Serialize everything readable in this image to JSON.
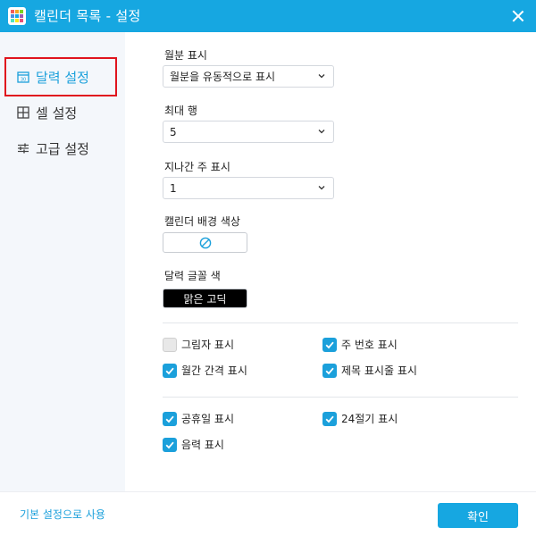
{
  "window": {
    "title": "캘린더 목록 - 설정",
    "accent_color": "#16a7e1"
  },
  "sidebar": {
    "items": [
      {
        "label": "달력 설정",
        "icon": "calendar-icon",
        "active": true
      },
      {
        "label": "셀 설정",
        "icon": "grid-icon",
        "active": false
      },
      {
        "label": "고급 설정",
        "icon": "sliders-icon",
        "active": false
      }
    ]
  },
  "main": {
    "monthly_display": {
      "label": "월분 표시",
      "value": "월분을 유동적으로 표시"
    },
    "max_rows": {
      "label": "최대 행",
      "value": "5"
    },
    "past_weeks": {
      "label": "지나간 주 표시",
      "value": "1"
    },
    "bg_color": {
      "label": "캘린더 배경 색상",
      "icon": "no-color-icon"
    },
    "font_color": {
      "label": "달력 글꼴 색",
      "value": "맑은 고딕"
    },
    "checkboxes_group1": [
      {
        "label": "그림자 표시",
        "checked": false
      },
      {
        "label": "주 번호 표시",
        "checked": true
      },
      {
        "label": "월간 간격 표시",
        "checked": true
      },
      {
        "label": "제목 표시줄 표시",
        "checked": true
      }
    ],
    "checkboxes_group2": [
      {
        "label": "공휴일 표시",
        "checked": true
      },
      {
        "label": "24절기 표시",
        "checked": true
      },
      {
        "label": "음력 표시",
        "checked": true
      }
    ]
  },
  "footer": {
    "reset_link": "기본 설정으로 사용",
    "ok_button": "확인"
  }
}
